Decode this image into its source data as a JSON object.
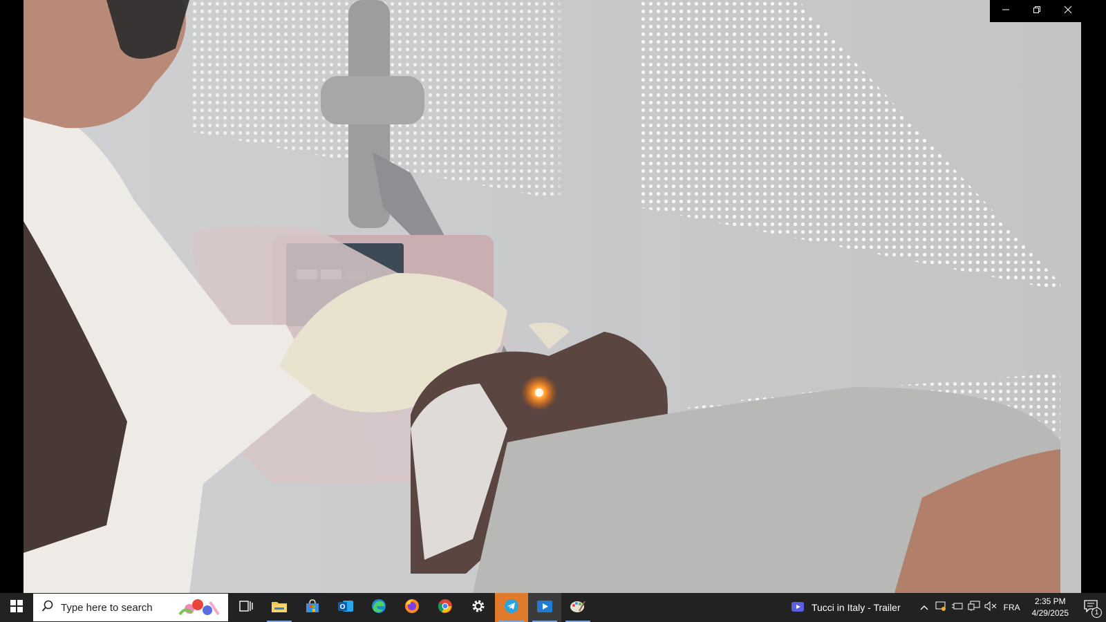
{
  "window": {
    "controls": {
      "minimize": "minimize-icon",
      "restore": "restore-icon",
      "close": "close-icon"
    }
  },
  "taskbar": {
    "start": "windows-logo-icon",
    "search": {
      "placeholder": "Type here to search"
    },
    "pinned": [
      "task-view-icon",
      "file-explorer-icon",
      "microsoft-store-icon",
      "outlook-icon",
      "edge-icon",
      "firefox-icon",
      "chrome-icon",
      "settings-icon",
      "telegram-icon",
      "media-player-icon",
      "paint-icon"
    ],
    "media": {
      "title": "Tucci in Italy - Trailer"
    },
    "tray": {
      "language": "FRA",
      "time": "2:35 PM",
      "date": "4/29/2025",
      "notifications_count": "1"
    }
  },
  "colors": {
    "taskbar_bg": "#222222",
    "accent_underline": "#7aa7dd",
    "highlight": "#3b3b3b"
  }
}
